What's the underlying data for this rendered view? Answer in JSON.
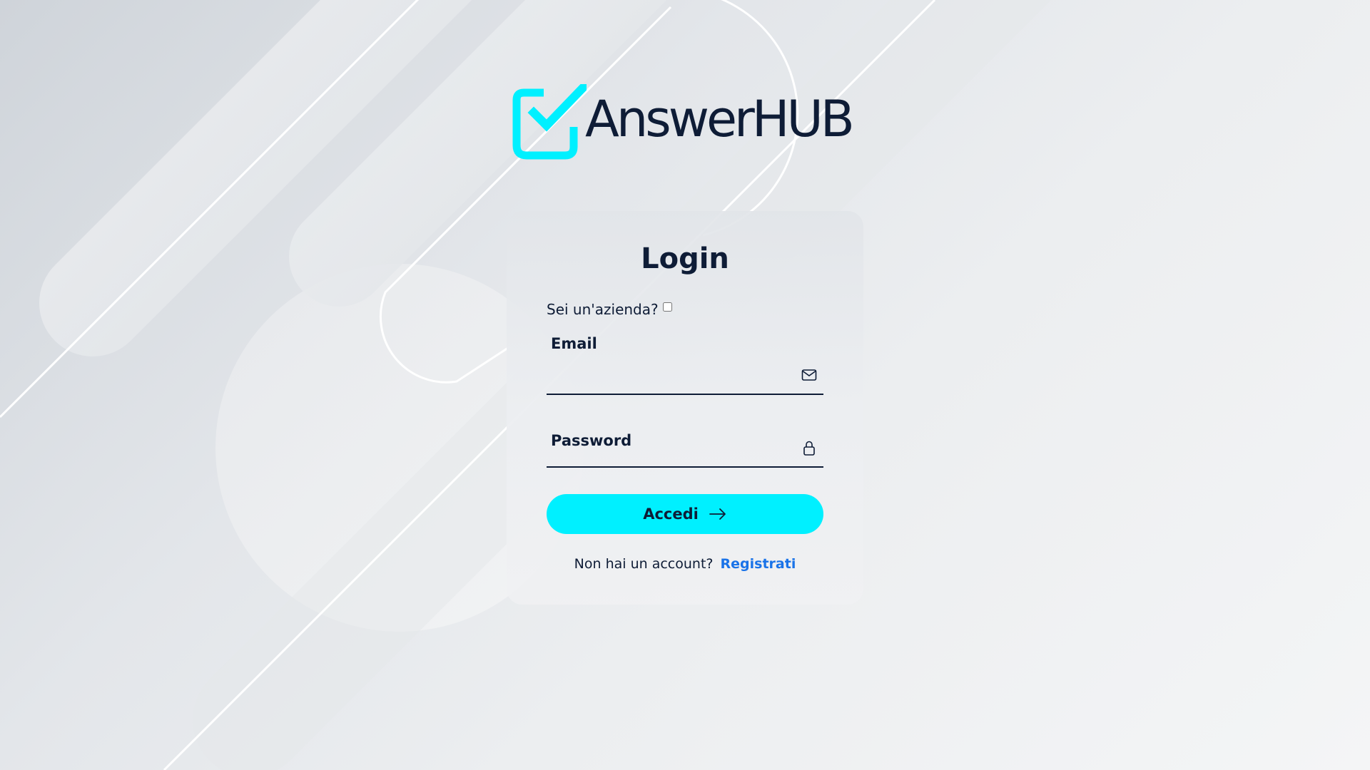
{
  "brand": {
    "name": "AnswerHUB",
    "accent_color": "#00f0ff",
    "text_color": "#0e1c36",
    "logo_icon": "checkbox-check-icon"
  },
  "login": {
    "title": "Login",
    "company_question": "Sei un'azienda?",
    "company_checked": false,
    "email": {
      "label": "Email",
      "value": "",
      "icon": "envelope-icon"
    },
    "password": {
      "label": "Password",
      "value": "",
      "icon": "lock-icon"
    },
    "submit_label": "Accedi",
    "submit_icon": "arrow-right-icon",
    "signup_prompt": "Non hai un account?",
    "signup_link": "Registrati",
    "link_color": "#1a73e8"
  }
}
